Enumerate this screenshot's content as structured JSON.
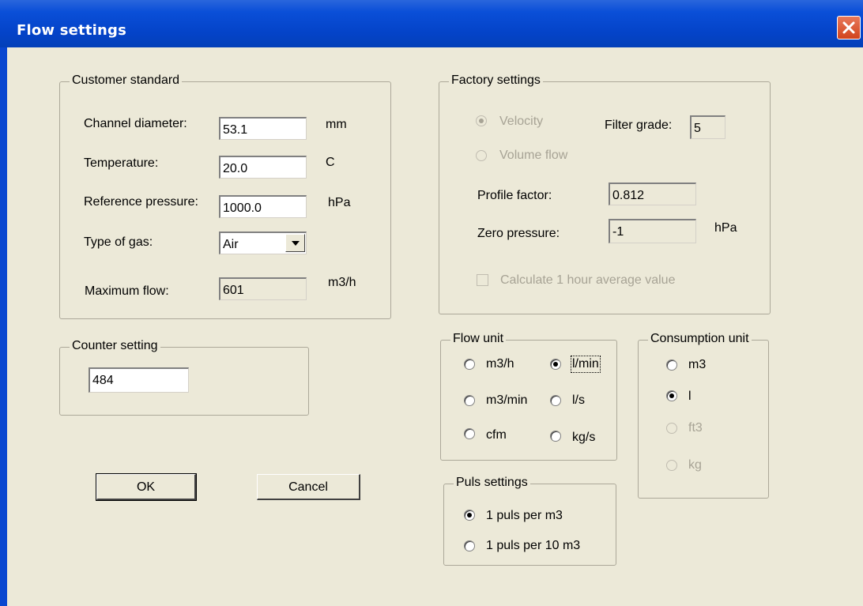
{
  "window": {
    "title": "Flow settings",
    "close_icon": "close-icon"
  },
  "customer_standard": {
    "legend": "Customer standard",
    "channel_diameter": {
      "label": "Channel diameter:",
      "value": "53.1",
      "unit": "mm"
    },
    "temperature": {
      "label": "Temperature:",
      "value": "20.0",
      "unit": "C"
    },
    "reference_pressure": {
      "label": "Reference pressure:",
      "value": "1000.0",
      "unit": "hPa"
    },
    "type_of_gas": {
      "label": "Type of gas:",
      "selected": "Air"
    },
    "maximum_flow": {
      "label": "Maximum flow:",
      "value": "601",
      "unit": "m3/h"
    }
  },
  "counter_setting": {
    "legend": "Counter setting",
    "value": "484"
  },
  "buttons": {
    "ok": "OK",
    "cancel": "Cancel"
  },
  "factory_settings": {
    "legend": "Factory settings",
    "velocity": "Velocity",
    "volume_flow": "Volume flow",
    "filter_grade": {
      "label": "Filter grade:",
      "value": "5"
    },
    "profile_factor": {
      "label": "Profile factor:",
      "value": "0.812"
    },
    "zero_pressure": {
      "label": "Zero pressure:",
      "value": "-1",
      "unit": "hPa"
    },
    "calculate_average": "Calculate 1 hour average value"
  },
  "flow_unit": {
    "legend": "Flow unit",
    "options": [
      "m3/h",
      "l/min",
      "m3/min",
      "l/s",
      "cfm",
      "kg/s"
    ],
    "selected": "l/min"
  },
  "consumption_unit": {
    "legend": "Consumption unit",
    "options": [
      "m3",
      "l",
      "ft3",
      "kg"
    ],
    "selected": "l"
  },
  "puls_settings": {
    "legend": "Puls settings",
    "options": [
      "1 puls per m3",
      "1 puls per 10 m3"
    ],
    "selected": "1 puls per m3"
  }
}
